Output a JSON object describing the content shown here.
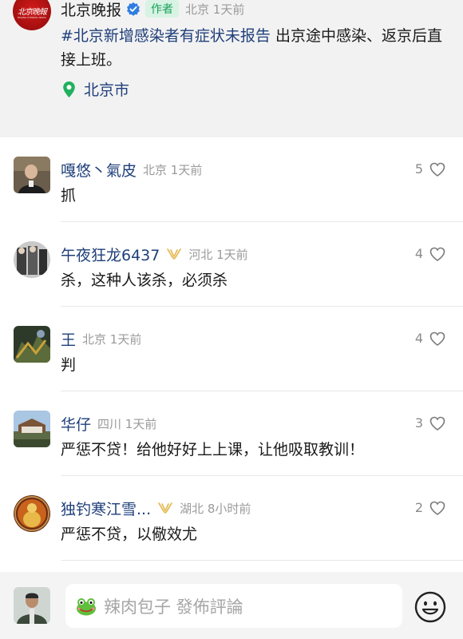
{
  "post": {
    "author": "北京晚报",
    "avatar_text": "北京晚報",
    "avatar_subtext": "BEIJING EVENING NEWS",
    "role_badge": "作者",
    "meta": "北京 1天前",
    "hashtag": "#北京新增感染者有症状未报告",
    "body": " 出京途中感染、返京后直接上班。",
    "location": "北京市"
  },
  "comments": [
    {
      "name": "嘎悠丶氣皮",
      "meta": "北京 1天前",
      "text": "抓",
      "likes": "5",
      "vip": false
    },
    {
      "name": "午夜狂龙6437",
      "meta": "河北 1天前",
      "text": "杀，这种人该杀，必须杀",
      "likes": "4",
      "vip": true
    },
    {
      "name": "王",
      "meta": "北京 1天前",
      "text": "判",
      "likes": "4",
      "vip": false
    },
    {
      "name": "华仔",
      "meta": "四川 1天前",
      "text": "严惩不贷！给他好好上上课，让他吸取教训！",
      "likes": "3",
      "vip": false
    },
    {
      "name": "独钓寒江雪...",
      "meta": "湖北 8小时前",
      "text": "严惩不贷，以儆效尤",
      "likes": "2",
      "vip": true
    }
  ],
  "composer": {
    "placeholder": "辣肉包子 發佈評論"
  },
  "icons": {
    "verified": "verified-check-icon",
    "location": "location-pin-icon",
    "like": "heart-outline-icon",
    "vip": "vip-crown-icon",
    "frog": "frog-emoji-icon",
    "emoji": "smiley-face-icon"
  },
  "colors": {
    "accent_green": "#18a058",
    "name_blue": "#1f3f7a",
    "brand_red": "#c81414"
  }
}
